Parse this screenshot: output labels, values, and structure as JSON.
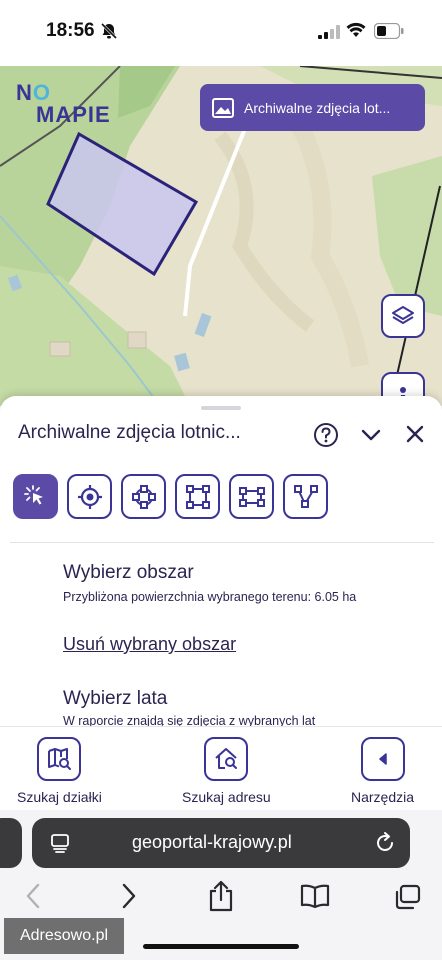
{
  "status_bar": {
    "time": "18:56"
  },
  "map": {
    "logo_part1": "N",
    "logo_o": "O",
    "logo_part2": "MAPIE",
    "archive_button_label": "Archiwalne zdjęcia lot..."
  },
  "sheet": {
    "title": "Archiwalne zdjęcia lotnic...",
    "tools": [
      "select-pointer-icon",
      "target-icon",
      "circle-nodes-icon",
      "square-nodes-icon",
      "rectangle-nodes-icon",
      "polyline-icon"
    ],
    "area": {
      "title": "Wybierz obszar",
      "subtitle": "Przybliżona powierzchnia wybranego terenu: 6.05 ha",
      "remove_link": "Usuń wybrany obszar"
    },
    "years": {
      "title": "Wybierz lata",
      "subtitle": "W raporcie znajdą się zdjęcia z wybranych lat"
    }
  },
  "actions": {
    "search_plot": "Szukaj działki",
    "search_address": "Szukaj adresu",
    "tools": "Narzędzia"
  },
  "browser": {
    "url": "geoportal-krajowy.pl"
  },
  "watermark": "Adresowo.pl",
  "colors": {
    "accent": "#5b4aa6",
    "outline": "#3b3497",
    "polygon_fill": "#c9c6ee"
  }
}
